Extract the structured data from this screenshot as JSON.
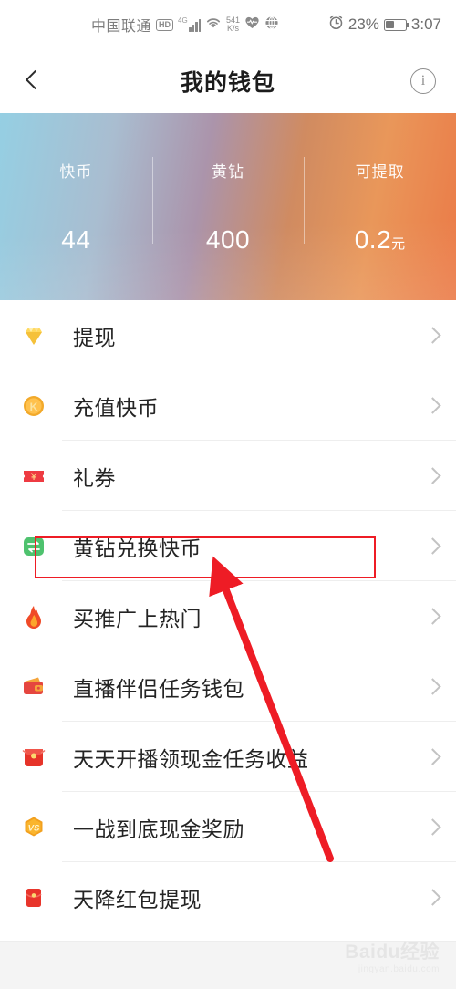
{
  "status_bar": {
    "carrier": "中国联通",
    "hd_badge": "HD",
    "network_type": "4G",
    "speed_value": "541",
    "speed_unit": "K/s",
    "battery_percent": "23%",
    "time": "3:07",
    "icons": [
      "hd-icon",
      "signal-icon",
      "wifi-icon",
      "network-speed-icon",
      "heart-icon",
      "globe-icon",
      "alarm-icon",
      "battery-icon"
    ]
  },
  "header": {
    "title": "我的钱包",
    "back_label": "返回",
    "info_label": "说明"
  },
  "balance": {
    "columns": [
      {
        "label": "快币",
        "value": "44",
        "unit": ""
      },
      {
        "label": "黄钻",
        "value": "400",
        "unit": ""
      },
      {
        "label": "可提取",
        "value": "0.2",
        "unit": "元"
      }
    ]
  },
  "menu": {
    "items": [
      {
        "label": "提现",
        "icon": "diamond-icon",
        "highlighted": false
      },
      {
        "label": "充值快币",
        "icon": "k-coin-icon",
        "highlighted": false
      },
      {
        "label": "礼券",
        "icon": "ticket-icon",
        "highlighted": false
      },
      {
        "label": "黄钻兑换快币",
        "icon": "exchange-icon",
        "highlighted": true
      },
      {
        "label": "买推广上热门",
        "icon": "flame-icon",
        "highlighted": false
      },
      {
        "label": "直播伴侣任务钱包",
        "icon": "wallet-icon",
        "highlighted": false
      },
      {
        "label": "天天开播领现金任务收益",
        "icon": "red-packet-icon",
        "highlighted": false
      },
      {
        "label": "一战到底现金奖励",
        "icon": "vs-badge-icon",
        "highlighted": false
      },
      {
        "label": "天降红包提现",
        "icon": "red-envelope-icon",
        "highlighted": false
      }
    ]
  },
  "annotation": {
    "highlight_color": "#ee1c25",
    "target_label": "黄钻兑换快币"
  },
  "watermark": {
    "main": "Baidu经验",
    "sub": "jingyan.baidu.com"
  }
}
